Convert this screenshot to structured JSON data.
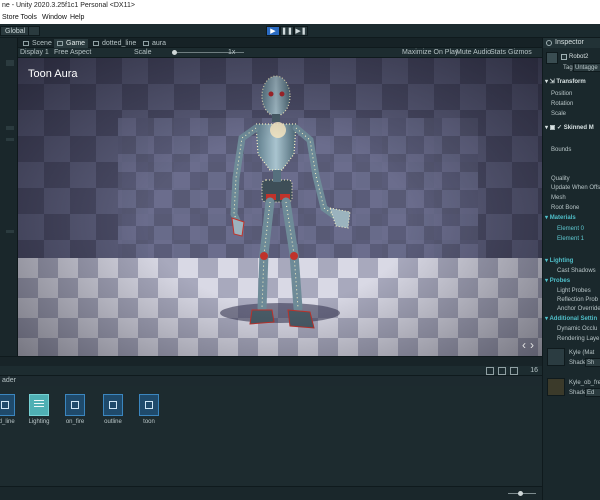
{
  "window": {
    "title": "ne - Unity 2020.3.25f1c1 Personal <DX11>"
  },
  "menu": {
    "items": [
      "Store Tools",
      "Window",
      "Help"
    ]
  },
  "toolbar": {
    "global_label": "Global"
  },
  "tabs": [
    "Scene",
    "Game",
    "dotted_line",
    "aura"
  ],
  "game_bar": {
    "display": "Display 1",
    "aspect": "Free Aspect",
    "scale_label": "Scale",
    "scale_value": "1x",
    "maximize": "Maximize On Play",
    "mute": "Mute Audio",
    "stats": "Stats",
    "gizmos": "Gizmos"
  },
  "viewport": {
    "label": "Toon Aura"
  },
  "inspector": {
    "tab": "Inspector",
    "object_name": "Robot2",
    "tag_label": "Tag",
    "tag_value": "Untagge",
    "transform": "Transform",
    "transform_fields": [
      "Position",
      "Rotation",
      "Scale"
    ],
    "skinned": "Skinned M",
    "bounds": "Bounds",
    "quality": "Quality",
    "update_offscreen": "Update When Offsc",
    "mesh": "Mesh",
    "root_bone": "Root Bone",
    "materials": "Materials",
    "element0": "Element 0",
    "element1": "Element 1",
    "lighting": "Lighting",
    "cast_shadows": "Cast Shadows",
    "probes": "Probes",
    "light_probes": "Light Probes",
    "reflection_probes": "Reflection Prob",
    "anchor_override": "Anchor Override",
    "additional": "Additional Settin",
    "dynamic_occlusion": "Dynamic Occlu",
    "rendering_layer": "Rendering Laye",
    "mat1_name": "Kyle (Mat",
    "mat1_shader_label": "Shader",
    "mat1_shader_value": "Sh",
    "mat2_name": "Kyle_ob_fre",
    "mat2_shader_label": "Shader",
    "mat2_shader_value": "Ed"
  },
  "project": {
    "breadcrumb": "ader",
    "count": "16",
    "assets": [
      {
        "label": "ed_line",
        "kind": "shader"
      },
      {
        "label": "Lighting",
        "kind": "doc"
      },
      {
        "label": "on_fire",
        "kind": "shader"
      },
      {
        "label": "outline",
        "kind": "shader"
      },
      {
        "label": "toon",
        "kind": "shader"
      }
    ]
  },
  "colors": {
    "accent": "#2a6bc2",
    "teal_section": "#4fbec8",
    "panel_bg": "#1d2a2f"
  }
}
